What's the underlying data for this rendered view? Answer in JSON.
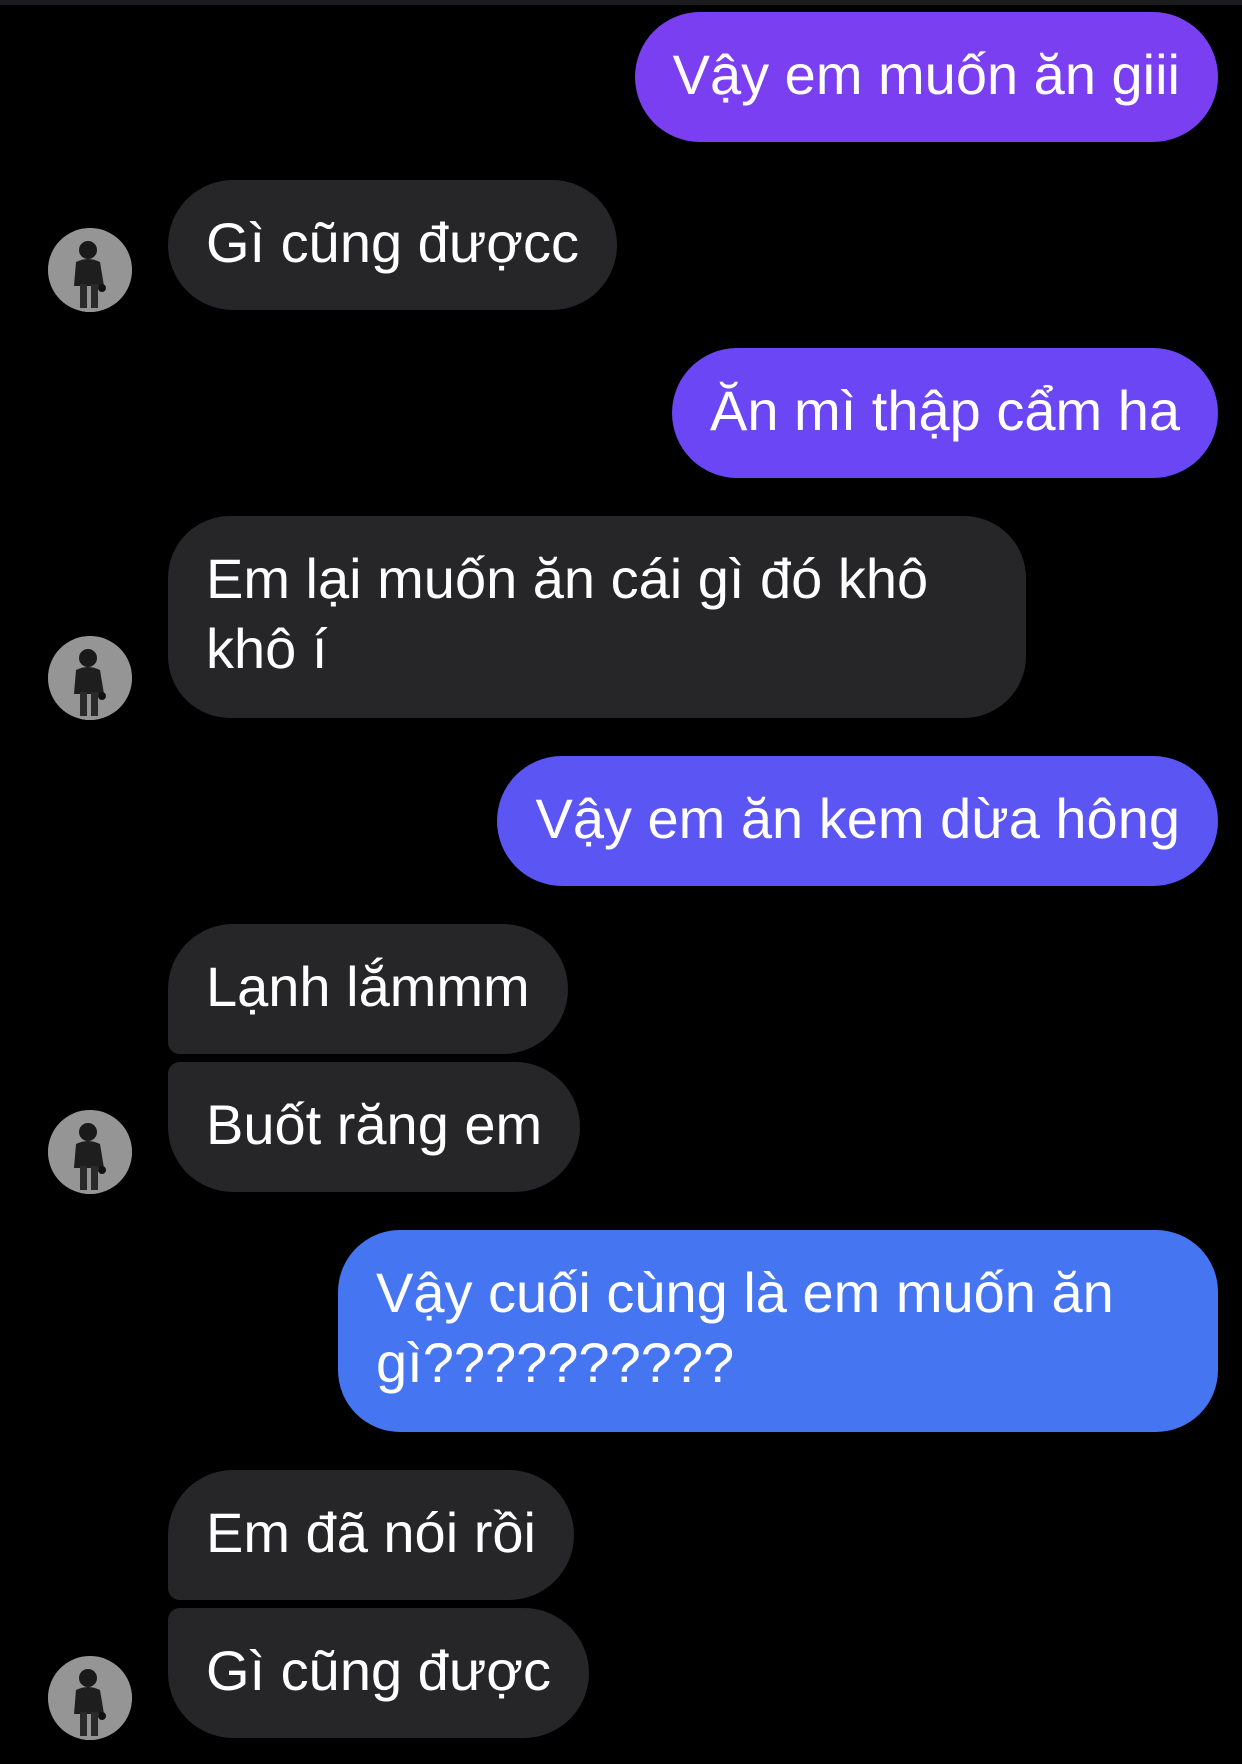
{
  "colors": {
    "background": "#000000",
    "received_bubble": "#262628",
    "sent_gradient": [
      "#7b3ff2",
      "#6a46f4",
      "#5b55f3",
      "#4d64f2",
      "#4575f0"
    ],
    "text": "#ffffff"
  },
  "messages": [
    {
      "sender": "me",
      "text": "Vậy em muốn ăn giii"
    },
    {
      "sender": "them",
      "text": "Gì cũng đượcc"
    },
    {
      "sender": "me",
      "text": "Ăn mì thập cẩm ha"
    },
    {
      "sender": "them",
      "text": "Em lại muốn ăn cái gì đó khô khô í"
    },
    {
      "sender": "me",
      "text": "Vậy em ăn kem dừa hông"
    },
    {
      "sender": "them",
      "text": "Lạnh lắmmm"
    },
    {
      "sender": "them",
      "text": "Buốt răng em"
    },
    {
      "sender": "me",
      "text": "Vậy cuối cùng là em muốn ăn gì??????????"
    },
    {
      "sender": "them",
      "text": "Em đã nói rồi"
    },
    {
      "sender": "them",
      "text": "Gì cũng được"
    }
  ],
  "avatar_icon": "user-avatar-icon"
}
